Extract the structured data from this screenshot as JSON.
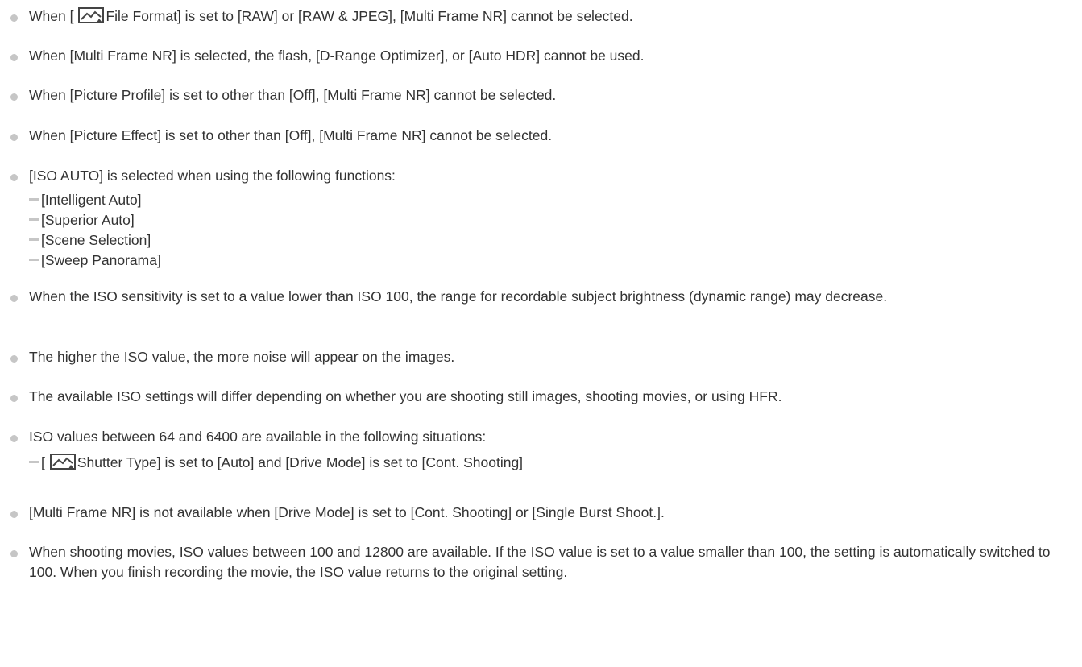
{
  "notes": [
    {
      "before": "When [",
      "icon": "still-image-icon",
      "after": "File Format] is set to [RAW] or [RAW & JPEG], [Multi Frame NR] cannot be selected."
    },
    {
      "text": "When [Multi Frame NR] is selected, the flash, [D-Range Optimizer], or [Auto HDR] cannot be used."
    },
    {
      "text": "When [Picture Profile] is set to other than [Off], [Multi Frame NR] cannot be selected."
    },
    {
      "text": "When [Picture Effect] is set to other than [Off], [Multi Frame NR] cannot be selected."
    },
    {
      "text": "[ISO AUTO] is selected when using the following functions:",
      "subitems": [
        "[Intelligent Auto]",
        "[Superior Auto]",
        "[Scene Selection]",
        "[Sweep Panorama]"
      ]
    },
    {
      "text": "When the ISO sensitivity is set to a value lower than ISO 100, the range for recordable subject brightness (dynamic range) may decrease."
    },
    {
      "text": "The higher the ISO value, the more noise will appear on the images."
    },
    {
      "text": "The available ISO settings will differ depending on whether you are shooting still images, shooting movies, or using HFR."
    },
    {
      "text": "ISO values between 64 and 6400 are available in the following situations:",
      "subitem": {
        "before": "[",
        "icon": "still-image-icon",
        "after": "Shutter Type] is set to [Auto] and [Drive Mode] is set to [Cont. Shooting]"
      }
    },
    {
      "text": "[Multi Frame NR] is not available when [Drive Mode] is set to [Cont. Shooting] or [Single Burst Shoot.]."
    },
    {
      "text": "When shooting movies, ISO values between 100 and 12800 are available. If the ISO value is set to a value smaller than 100, the setting is automatically switched to 100. When you finish recording the movie, the ISO value returns to the original setting."
    }
  ]
}
